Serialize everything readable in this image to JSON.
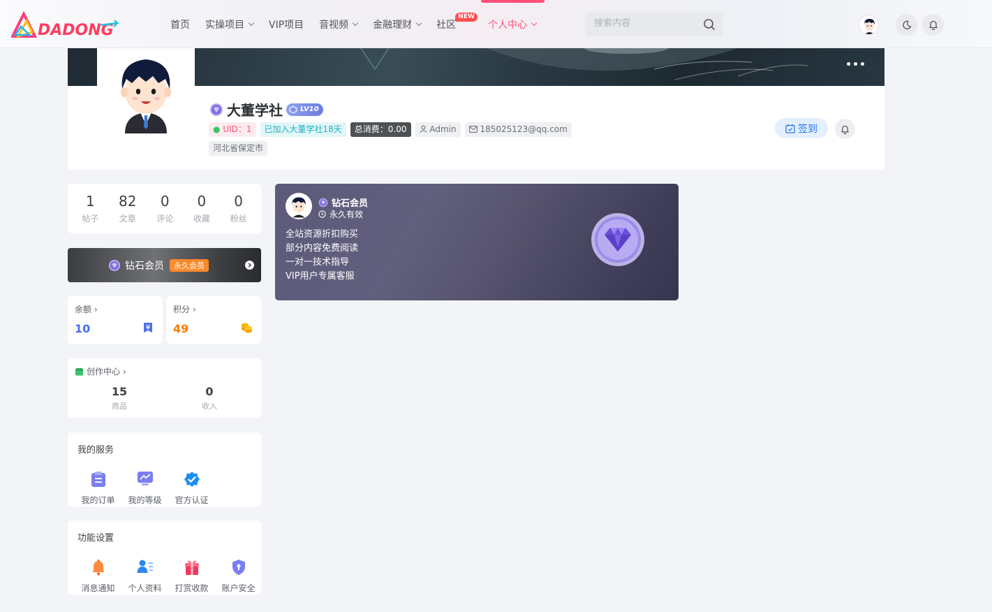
{
  "brand": {
    "logo_text": "DADONG"
  },
  "nav": {
    "items": [
      {
        "label": "首页",
        "has_menu": false
      },
      {
        "label": "实操项目",
        "has_menu": true
      },
      {
        "label": "VIP项目",
        "has_menu": false
      },
      {
        "label": "音视频",
        "has_menu": true
      },
      {
        "label": "金融理财",
        "has_menu": true
      },
      {
        "label": "社区",
        "has_menu": false,
        "badge": "NEW"
      },
      {
        "label": "个人中心",
        "has_menu": true,
        "active": true
      }
    ]
  },
  "search": {
    "placeholder": "搜索内容",
    "icon": "search-icon"
  },
  "header_actions": {
    "theme_icon": "moon-icon",
    "notify_icon": "bell-icon"
  },
  "profile": {
    "name": "大董学社",
    "level": "LV10",
    "more_icon": "more-dots-icon",
    "uid": "UID：1",
    "joined": "已加入大董学社18天",
    "spend": "总消费：0.00",
    "role": "Admin",
    "email": "185025123@qq.com",
    "location": "河北省保定市",
    "signin_label": "签到"
  },
  "stats": [
    {
      "value": "1",
      "label": "帖子"
    },
    {
      "value": "82",
      "label": "文章"
    },
    {
      "value": "0",
      "label": "评论"
    },
    {
      "value": "0",
      "label": "收藏"
    },
    {
      "value": "0",
      "label": "粉丝"
    }
  ],
  "vip_bar": {
    "label": "钻石会员",
    "badge": "永久会员"
  },
  "balance": {
    "title": "余额",
    "value": "10",
    "color": "#4b6ef0"
  },
  "points": {
    "title": "积分",
    "value": "49",
    "color": "#f57c00"
  },
  "creation": {
    "title": "创作中心",
    "items": [
      {
        "value": "15",
        "label": "商品"
      },
      {
        "value": "0",
        "label": "收入"
      }
    ]
  },
  "services": {
    "title": "我的服务",
    "items": [
      {
        "label": "我的订单",
        "icon": "order-icon"
      },
      {
        "label": "我的等级",
        "icon": "level-chart-icon"
      },
      {
        "label": "官方认证",
        "icon": "verified-badge-icon"
      }
    ]
  },
  "settings": {
    "title": "功能设置",
    "items": [
      {
        "label": "消息通知",
        "icon": "bell-icon"
      },
      {
        "label": "个人资料",
        "icon": "profile-card-icon"
      },
      {
        "label": "打赏收款",
        "icon": "gift-icon"
      },
      {
        "label": "账户安全",
        "icon": "shield-icon"
      }
    ]
  },
  "vip_card": {
    "name": "钻石会员",
    "validity": "永久有效",
    "perks": [
      "全站资源折扣购买",
      "部分内容免费阅读",
      "一对一技术指导",
      "VIP用户专属客服"
    ]
  },
  "colors": {
    "accent": "#ff4f7b",
    "signin": "#2e7bea",
    "vip_gradient": "#5d5a7a"
  }
}
